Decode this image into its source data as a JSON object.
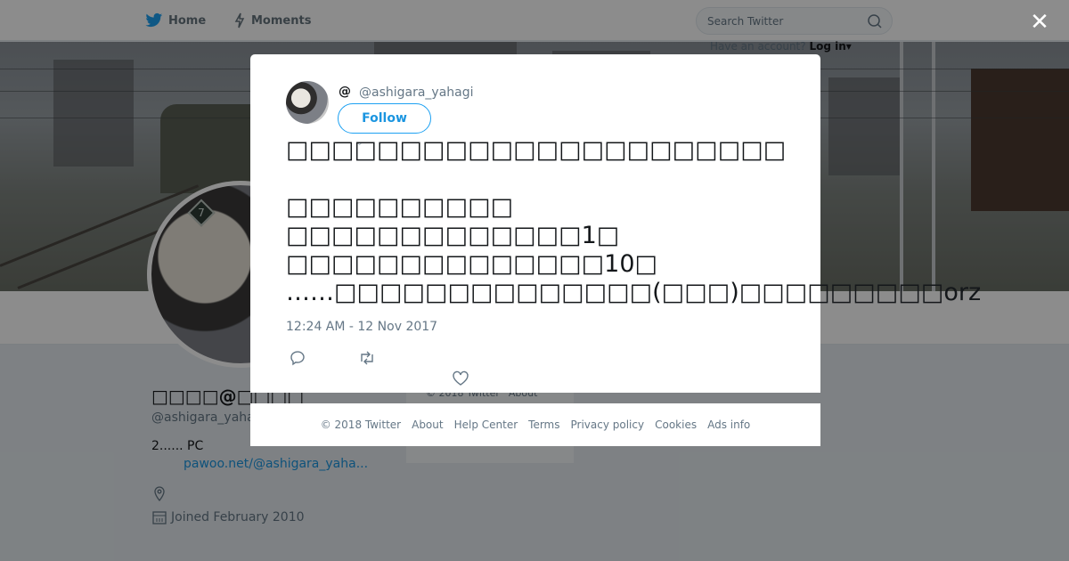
{
  "nav": {
    "home_label": "Home",
    "moments_label": "Moments",
    "search_placeholder": "Search Twitter",
    "have_account": "Have an account?",
    "login": "Log in"
  },
  "profile": {
    "name": "□□□□@□□□□",
    "handle": "@ashigara_yaha",
    "bio": "2...... PC",
    "link": "pawoo.net/@ashigara_yaha...",
    "joined": "Joined February 2010"
  },
  "under_footer": {
    "copyright": "© 2018 Twitter",
    "about": "About"
  },
  "modal": {
    "name": "@",
    "handle": "@ashigara_yahagi",
    "follow": "Follow",
    "lines": [
      "□□□□□□□□□□□□□□□□□□□□□□",
      "",
      "□□□□□□□□□□",
      "□□□□□□□□□□□□□1□",
      "□□□□□□□□□□□□□□10□",
      "……□□□□□□□□□□□□□□(□□□)□□□□□□□□□orz"
    ],
    "timestamp": "12:24 AM - 12 Nov 2017"
  },
  "footer": {
    "links": [
      "© 2018 Twitter",
      "About",
      "Help Center",
      "Terms",
      "Privacy policy",
      "Cookies",
      "Ads info"
    ]
  },
  "icons": {
    "brand_color": "#1da1f2",
    "close": "close-icon",
    "reply": "reply-icon",
    "retweet": "retweet-icon",
    "like": "heart-icon"
  }
}
